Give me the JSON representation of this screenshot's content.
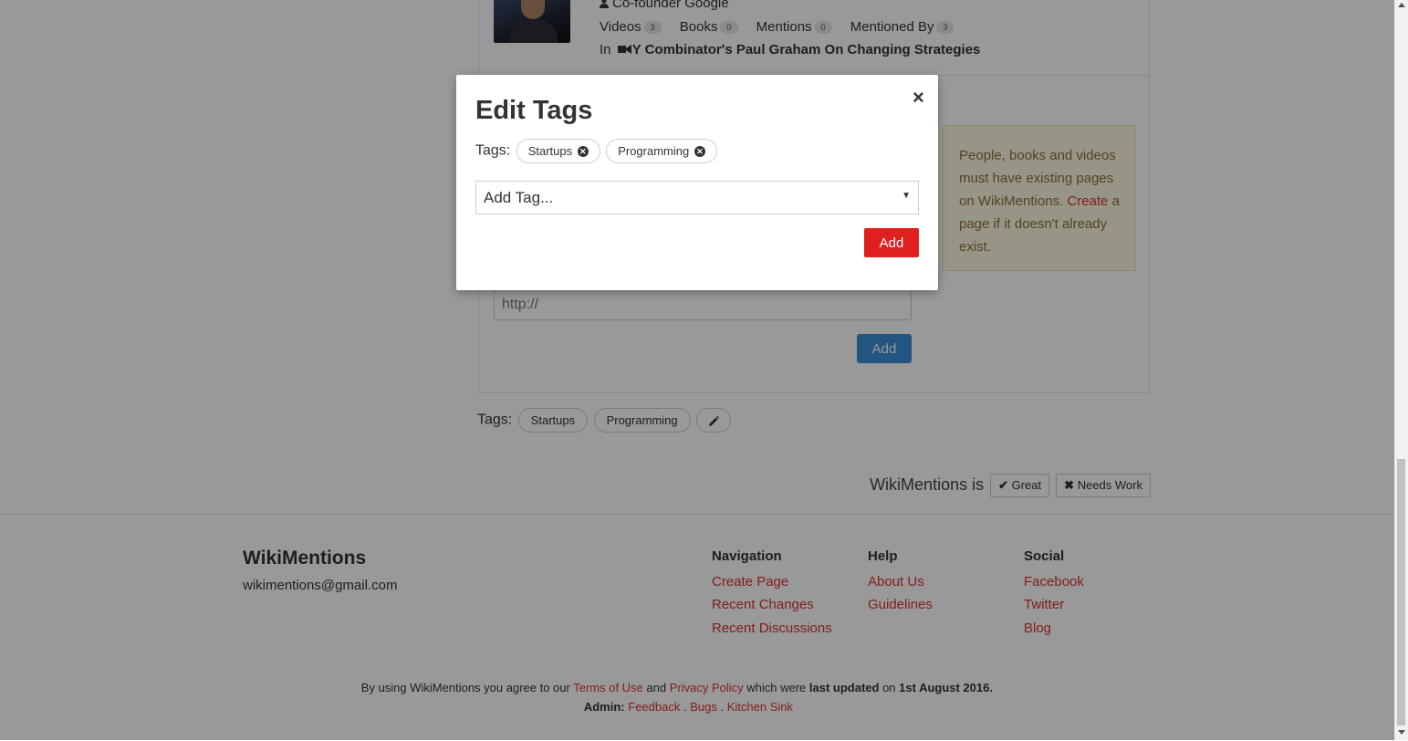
{
  "person": {
    "role": "Co-founder Google",
    "stats": [
      {
        "label": "Videos",
        "count": "3"
      },
      {
        "label": "Books",
        "count": "0"
      },
      {
        "label": "Mentions",
        "count": "0"
      },
      {
        "label": "Mentioned By",
        "count": "3"
      }
    ],
    "in_prefix": "In",
    "in_title": "Y Combinator's Paul Graham On Changing Strategies"
  },
  "note": {
    "text_before": "People, books and videos must have existing pages on WikiMentions. ",
    "link": "Create",
    "text_after": " a page if it doesn't already exist."
  },
  "url_input": {
    "placeholder": "http://"
  },
  "add_button_label": "Add",
  "page_tags": {
    "label": "Tags:",
    "items": [
      "Startups",
      "Programming"
    ]
  },
  "feedback": {
    "prefix": "WikiMentions is",
    "great": "Great",
    "needs_work": "Needs Work"
  },
  "footer": {
    "brand": "WikiMentions",
    "email": "wikimentions@gmail.com",
    "navigation": {
      "title": "Navigation",
      "links": [
        "Create Page",
        "Recent Changes",
        "Recent Discussions"
      ]
    },
    "help": {
      "title": "Help",
      "links": [
        "About Us",
        "Guidelines"
      ]
    },
    "social": {
      "title": "Social",
      "links": [
        "Facebook",
        "Twitter",
        "Blog"
      ]
    },
    "legal": {
      "t1": "By using WikiMentions you agree to our ",
      "terms": "Terms of Use",
      "t2": " and ",
      "privacy": "Privacy Policy",
      "t3": " which were ",
      "updated": "last updated",
      "t4": " on ",
      "date": "1st August 2016."
    },
    "admin": {
      "label": "Admin:",
      "links": [
        "Feedback",
        "Bugs",
        "Kitchen Sink"
      ],
      "sep": "."
    }
  },
  "modal": {
    "title": "Edit Tags",
    "close": "×",
    "tags_label": "Tags:",
    "tags": [
      "Startups",
      "Programming"
    ],
    "select_placeholder": "Add Tag...",
    "select_arrow": "▼",
    "add_label": "Add"
  }
}
